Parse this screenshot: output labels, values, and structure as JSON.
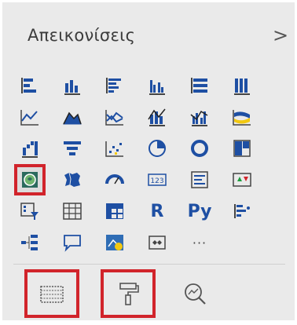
{
  "pane": {
    "title": "Απεικονίσεις",
    "expand_glyph": ">"
  },
  "colors": {
    "accent": "#1e4fa3",
    "highlight": "#d1242b",
    "yellow": "#f2c811"
  },
  "visuals": {
    "r_label": "R",
    "py_label": "Py",
    "card_label": "123",
    "more_label": "···"
  },
  "tabs": [
    "fields-tab",
    "format-tab",
    "analytics-tab"
  ]
}
